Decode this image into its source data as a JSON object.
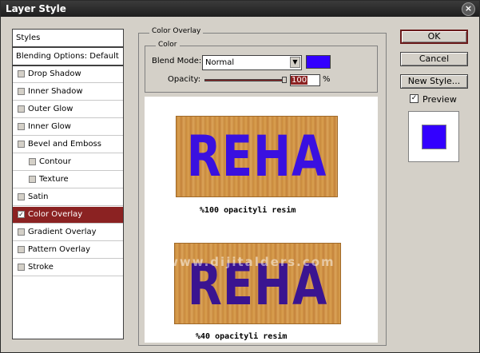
{
  "window": {
    "title": "Layer Style"
  },
  "styles_panel": {
    "header": "Styles",
    "blending": "Blending Options: Default",
    "items": [
      {
        "label": "Drop Shadow",
        "checked": false
      },
      {
        "label": "Inner Shadow",
        "checked": false
      },
      {
        "label": "Outer Glow",
        "checked": false
      },
      {
        "label": "Inner Glow",
        "checked": false
      },
      {
        "label": "Bevel and Emboss",
        "checked": false
      },
      {
        "label": "Contour",
        "checked": false
      },
      {
        "label": "Texture",
        "checked": false
      },
      {
        "label": "Satin",
        "checked": false
      },
      {
        "label": "Color Overlay",
        "checked": true
      },
      {
        "label": "Gradient Overlay",
        "checked": false
      },
      {
        "label": "Pattern Overlay",
        "checked": false
      },
      {
        "label": "Stroke",
        "checked": false
      }
    ]
  },
  "overlay": {
    "group_title": "Color Overlay",
    "subgroup_title": "Color",
    "blend_mode_label": "Blend Mode:",
    "blend_mode_value": "Normal",
    "color_hex": "#3300ff",
    "opacity_label": "Opacity:",
    "opacity_value": "100",
    "opacity_unit": "%",
    "opacity_fraction": 1.0
  },
  "buttons": {
    "ok": "OK",
    "cancel": "Cancel",
    "new_style": "New Style...",
    "preview_label": "Preview",
    "preview_checked": true
  },
  "canvas": {
    "image1": {
      "text": "REHA",
      "caption": "%100 opacityli resim",
      "text_color": "#3a10e0"
    },
    "image2": {
      "text": "REHA",
      "caption": "%40 opacityli resim",
      "text_color": "#3a1490"
    },
    "watermark": "www.dijitalders.com"
  },
  "colors": {
    "selected_bg": "#8b2222",
    "preview_swatch": "#3300ff"
  }
}
